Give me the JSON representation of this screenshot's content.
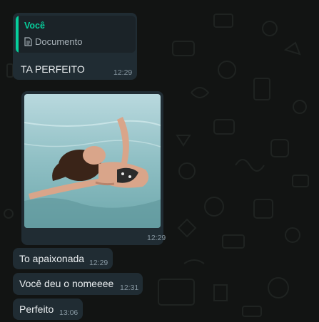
{
  "quoted": {
    "author": "Você",
    "label": "Documento",
    "icon": "document-icon"
  },
  "messages": [
    {
      "text": "TA PERFEITO",
      "time": "12:29"
    },
    {
      "image": "swimming-pool-photo",
      "time": "12:29"
    },
    {
      "text": "To apaixonada",
      "time": "12:29"
    },
    {
      "text": "Você deu o nomeeee",
      "time": "12:31"
    },
    {
      "text": "Perfeito",
      "time": "13:06"
    }
  ],
  "colors": {
    "background": "#121413",
    "bubble": "#202c33",
    "accent": "#06cf9c",
    "timestamp": "#8696a0"
  }
}
